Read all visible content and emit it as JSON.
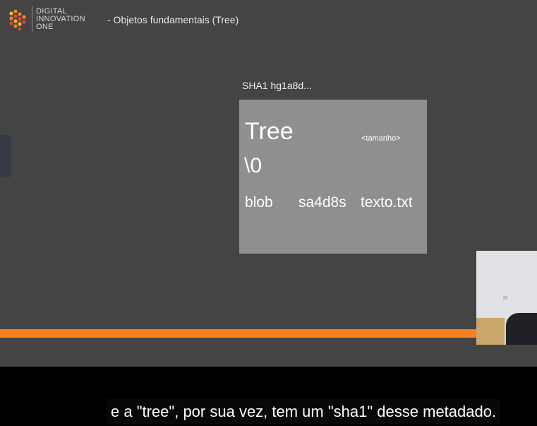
{
  "logo": {
    "line1": "DIGITAL",
    "line2": "INNOVATION",
    "line3": "ONE",
    "colors": [
      "#f5821f",
      "#e0483a",
      "#f7b733"
    ]
  },
  "slide": {
    "title": "- Objetos fundamentais (Tree)",
    "sha_label": "SHA1 hg1a8d...",
    "tree": {
      "type": "Tree",
      "size": "<tamanho>",
      "null_char": "\\0",
      "entry": {
        "mode": "blob",
        "hash": "sa4d8s",
        "name": "texto.txt"
      }
    },
    "accent_color": "#f5821f"
  },
  "caption": {
    "text": "e a \"tree\", por sua vez, tem um \"sha1\" desse metadado."
  }
}
